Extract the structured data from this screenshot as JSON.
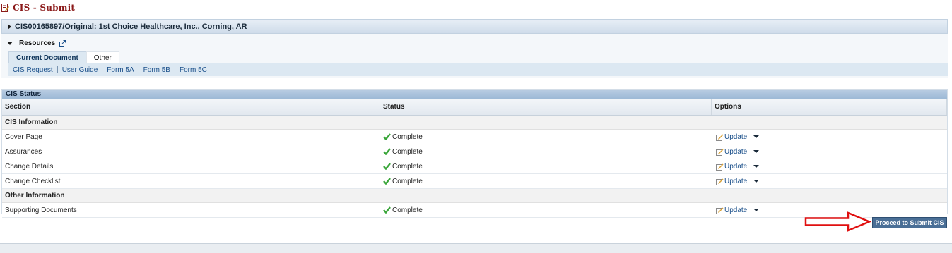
{
  "page": {
    "title": "CIS - Submit"
  },
  "cis_bar": {
    "title": "CIS00165897/Original: 1st Choice Healthcare, Inc., Corning, AR"
  },
  "resources": {
    "label": "Resources",
    "tabs": [
      {
        "label": "Current Document",
        "active": true
      },
      {
        "label": "Other",
        "active": false
      }
    ],
    "links": [
      "CIS Request",
      "User Guide",
      "Form 5A",
      "Form 5B",
      "Form 5C"
    ]
  },
  "status_panel": {
    "title": "CIS Status",
    "columns": [
      "Section",
      "Status",
      "Options"
    ],
    "groups": [
      {
        "name": "CIS Information",
        "rows": [
          {
            "section": "Cover Page",
            "status": "Complete",
            "option": "Update"
          },
          {
            "section": "Assurances",
            "status": "Complete",
            "option": "Update"
          },
          {
            "section": "Change Details",
            "status": "Complete",
            "option": "Update"
          },
          {
            "section": "Change Checklist",
            "status": "Complete",
            "option": "Update"
          }
        ]
      },
      {
        "name": "Other Information",
        "rows": [
          {
            "section": "Supporting Documents",
            "status": "Complete",
            "option": "Update"
          }
        ]
      }
    ]
  },
  "actions": {
    "proceed_label": "Proceed to Submit CIS"
  },
  "icons": {
    "page": "document-edit-icon",
    "expand": "triangle-right-icon",
    "collapse": "triangle-down-icon",
    "external": "external-link-icon",
    "complete": "checkmark-icon",
    "edit": "pencil-edit-icon",
    "menu": "chevron-down-icon",
    "pointer": "red-arrow-icon"
  },
  "colors": {
    "title": "#8b1a1a",
    "accent": "#4a6f96",
    "complete": "#3aa63a",
    "arrow": "#e01010"
  }
}
